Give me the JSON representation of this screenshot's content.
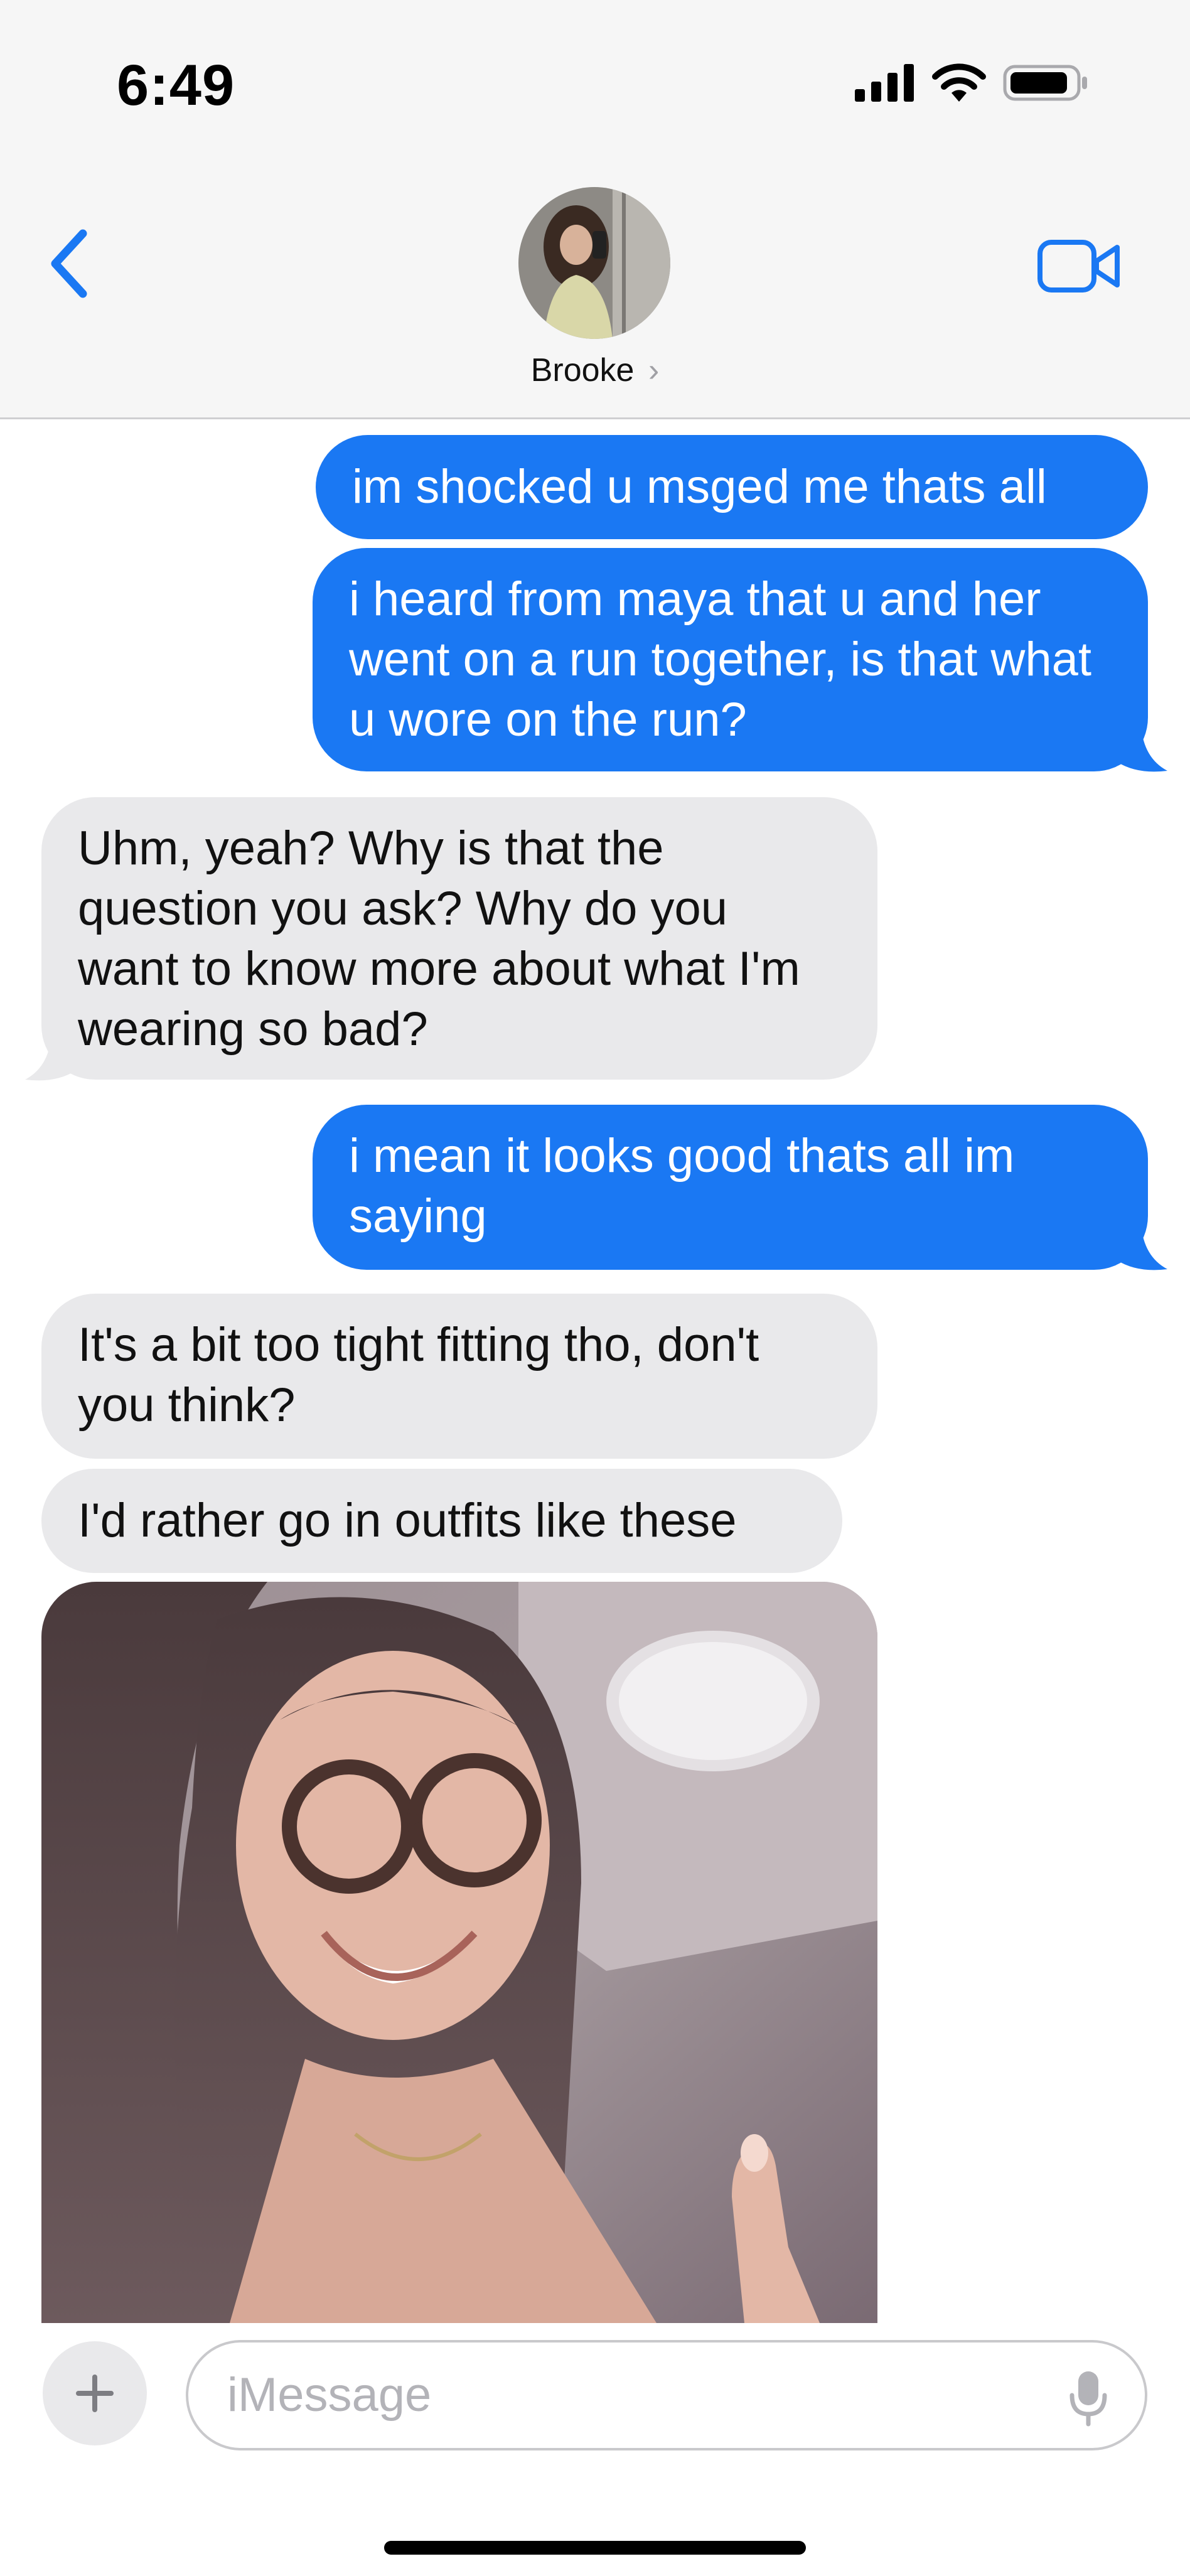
{
  "status_bar": {
    "time": "6:49"
  },
  "header": {
    "contact_name": "Brooke",
    "chevron": "›"
  },
  "messages": [
    {
      "id": "m1",
      "direction": "outgoing",
      "text": "im shocked u msged me thats all"
    },
    {
      "id": "m2",
      "direction": "outgoing",
      "text": "i heard from maya that u and her went on a run together, is that what u wore on the run?"
    },
    {
      "id": "m3",
      "direction": "incoming",
      "text": "Uhm, yeah? Why is that the question you ask? Why do you want to know more about what I'm wearing so bad?"
    },
    {
      "id": "m4",
      "direction": "outgoing",
      "text": "i mean it looks good thats all im saying"
    },
    {
      "id": "m5",
      "direction": "incoming",
      "text": "It's a bit too tight fitting tho, don't you think?"
    },
    {
      "id": "m6",
      "direction": "incoming",
      "text": "I'd rather go in outfits like these"
    }
  ],
  "composer": {
    "placeholder": "iMessage"
  },
  "colors": {
    "outgoing_bubble": "#1a78f3",
    "incoming_bubble": "#e9e9eb",
    "accent": "#1a78f3",
    "header_bg": "#f6f6f6"
  },
  "icons": [
    "back-chevron-icon",
    "video-call-icon",
    "cellular-signal-icon",
    "wifi-icon",
    "battery-icon",
    "plus-icon",
    "microphone-icon"
  ]
}
